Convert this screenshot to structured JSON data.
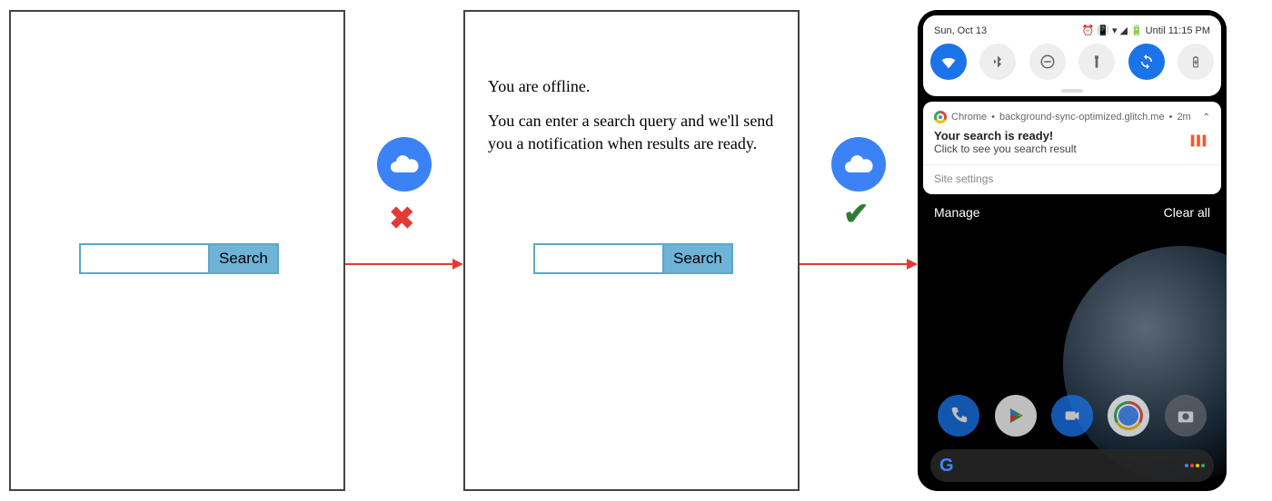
{
  "panel1": {
    "search_value": "",
    "search_button": "Search"
  },
  "connector1": {
    "status": "offline-fail"
  },
  "panel2": {
    "offline_title": "You are offline.",
    "offline_body": "You can enter a search query and we'll send you a notification when results are ready.",
    "search_value": "",
    "search_button": "Search"
  },
  "connector2": {
    "status": "online-success"
  },
  "phone": {
    "status_bar": {
      "date": "Sun, Oct 13",
      "right_text": "Until 11:15 PM"
    },
    "quick_settings": {
      "tiles": [
        {
          "name": "wifi",
          "active": true
        },
        {
          "name": "bluetooth",
          "active": false
        },
        {
          "name": "dnd",
          "active": false
        },
        {
          "name": "flashlight",
          "active": false
        },
        {
          "name": "auto-rotate",
          "active": true
        },
        {
          "name": "battery-saver",
          "active": false
        }
      ]
    },
    "notification": {
      "app": "Chrome",
      "source": "background-sync-optimized.glitch.me",
      "age": "2m",
      "title": "Your search is ready!",
      "body": "Click to see you search result",
      "settings_label": "Site settings"
    },
    "shade_actions": {
      "manage": "Manage",
      "clear_all": "Clear all"
    },
    "dock": [
      {
        "name": "phone",
        "bg": "#1a73e8"
      },
      {
        "name": "play-store",
        "bg": "#ffffff"
      },
      {
        "name": "duo",
        "bg": "#1a73e8"
      },
      {
        "name": "chrome",
        "bg": "#ffffff"
      },
      {
        "name": "camera",
        "bg": "#5f6368"
      }
    ]
  }
}
